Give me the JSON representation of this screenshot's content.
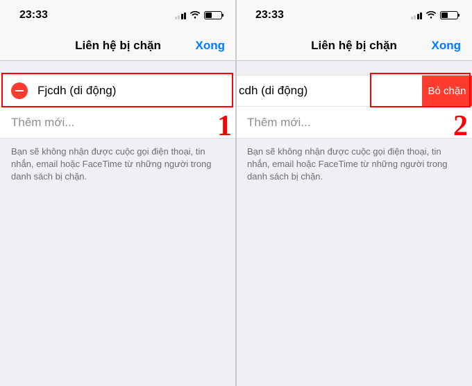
{
  "status": {
    "time": "23:33"
  },
  "nav": {
    "title": "Liên hệ bị chặn",
    "done": "Xong"
  },
  "left": {
    "contact_name": "Fjcdh (di động)",
    "step_label": "1"
  },
  "right": {
    "contact_partial": "cdh (di động)",
    "unblock_label": "Bỏ chặn",
    "step_label": "2"
  },
  "add_new": "Thêm mới...",
  "footer_info": "Bạn sẽ không nhận được cuộc gọi điện thoại, tin nhắn, email hoặc FaceTime từ những người trong danh sách bị chặn."
}
